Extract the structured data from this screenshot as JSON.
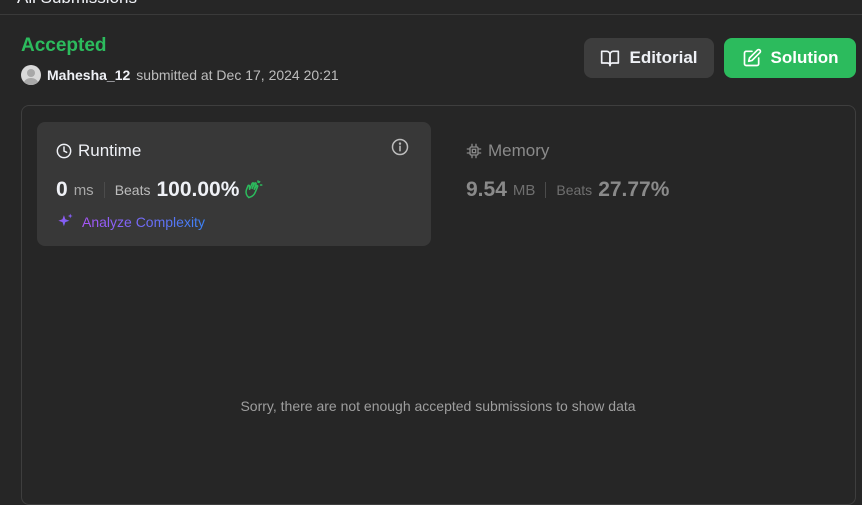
{
  "header": {
    "title": "All Submissions"
  },
  "submission": {
    "status": "Accepted",
    "username": "Mahesha_12",
    "submitted_text": "submitted at Dec 17, 2024 20:21"
  },
  "buttons": {
    "editorial": "Editorial",
    "solution": "Solution"
  },
  "runtime": {
    "title": "Runtime",
    "value": "0",
    "unit": "ms",
    "beats_label": "Beats",
    "beats_value": "100.00%",
    "analyze_label": "Analyze Complexity"
  },
  "memory": {
    "title": "Memory",
    "value": "9.54",
    "unit": "MB",
    "beats_label": "Beats",
    "beats_value": "27.77%"
  },
  "empty_message": "Sorry, there are not enough accepted submissions to show data",
  "colors": {
    "accepted": "#2cbb5d",
    "background": "#262626",
    "card": "#383838",
    "analyze": "#8b5cf6"
  },
  "icons": [
    "book-icon",
    "edit-icon",
    "clock-icon",
    "info-icon",
    "clap-icon",
    "sparkle-icon",
    "chip-icon"
  ]
}
